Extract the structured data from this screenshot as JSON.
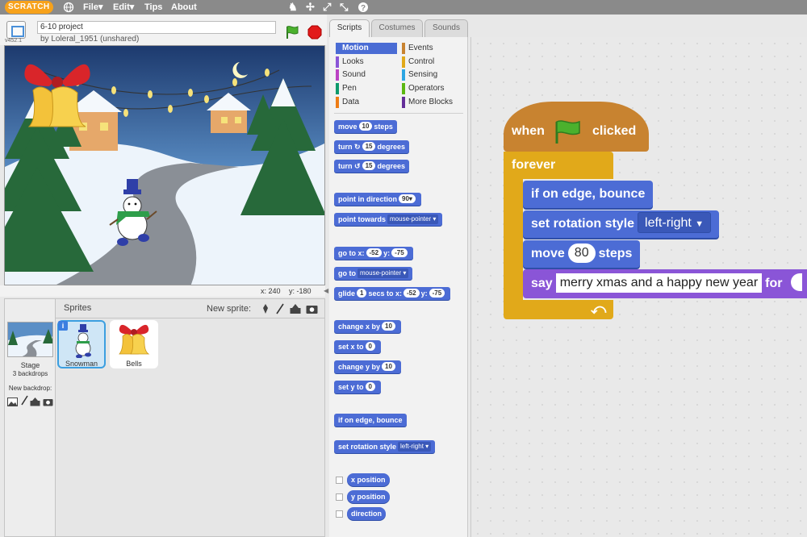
{
  "menubar": {
    "logo": "SCRATCH",
    "file": "File▾",
    "edit": "Edit▾",
    "tips": "Tips",
    "about": "About",
    "tools": [
      "stamp-icon",
      "scissors-icon",
      "grow-icon",
      "shrink-icon",
      "help-icon"
    ]
  },
  "project": {
    "title": "6-10 project",
    "owner": "by Loleral_1951 (unshared)",
    "version": "v452.1"
  },
  "stage": {
    "x_label": "x:",
    "x_value": "240",
    "y_label": "y:",
    "y_value": "-180"
  },
  "sprites": {
    "header": "Sprites",
    "new_sprite": "New sprite:",
    "stage_label": "Stage",
    "stage_backdrops": "3 backdrops",
    "new_backdrop": "New backdrop:",
    "items": [
      {
        "name": "Snowman",
        "selected": true
      },
      {
        "name": "Bells",
        "selected": false
      }
    ]
  },
  "tabs": [
    "Scripts",
    "Costumes",
    "Sounds"
  ],
  "categories": [
    {
      "name": "Motion",
      "color": "#4a6cd4"
    },
    {
      "name": "Events",
      "color": "#c88330"
    },
    {
      "name": "Looks",
      "color": "#8a55d7"
    },
    {
      "name": "Control",
      "color": "#e1a91a"
    },
    {
      "name": "Sound",
      "color": "#bb42c3"
    },
    {
      "name": "Sensing",
      "color": "#2ca5e2"
    },
    {
      "name": "Pen",
      "color": "#0e9a6c"
    },
    {
      "name": "Operators",
      "color": "#5cb712"
    },
    {
      "name": "Data",
      "color": "#ee7d16"
    },
    {
      "name": "More Blocks",
      "color": "#632d99"
    }
  ],
  "palette": {
    "move": {
      "a": "move",
      "v": "10",
      "b": "steps"
    },
    "turn_cw": {
      "a": "turn",
      "v": "15",
      "b": "degrees"
    },
    "turn_ccw": {
      "a": "turn",
      "v": "15",
      "b": "degrees"
    },
    "point_dir": {
      "a": "point in direction",
      "v": "90▾"
    },
    "point_towards": {
      "a": "point towards",
      "v": "mouse-pointer ▾"
    },
    "goto_xy": {
      "a": "go to x:",
      "x": "-52",
      "ylbl": "y:",
      "y": "-75"
    },
    "goto": {
      "a": "go to",
      "v": "mouse-pointer ▾"
    },
    "glide": {
      "a": "glide",
      "v": "1",
      "b": "secs to x:",
      "x": "-52",
      "ylbl": "y:",
      "y": "-75"
    },
    "change_x": {
      "a": "change x by",
      "v": "10"
    },
    "set_x": {
      "a": "set x to",
      "v": "0"
    },
    "change_y": {
      "a": "change y by",
      "v": "10"
    },
    "set_y": {
      "a": "set y to",
      "v": "0"
    },
    "edge_bounce": "if on edge, bounce",
    "rotation": {
      "a": "set rotation style",
      "v": "left-right ▾"
    },
    "x_position": "x position",
    "y_position": "y position",
    "direction": "direction"
  },
  "script": {
    "hat_when": "when",
    "hat_clicked": "clicked",
    "forever": "forever",
    "bounce": "if on edge, bounce",
    "rotation_label": "set rotation style",
    "rotation_value": "left-right",
    "move_label": "move",
    "move_value": "80",
    "move_steps": "steps",
    "say_label": "say",
    "say_text": "merry xmas and a happy new year",
    "say_for": "for"
  }
}
